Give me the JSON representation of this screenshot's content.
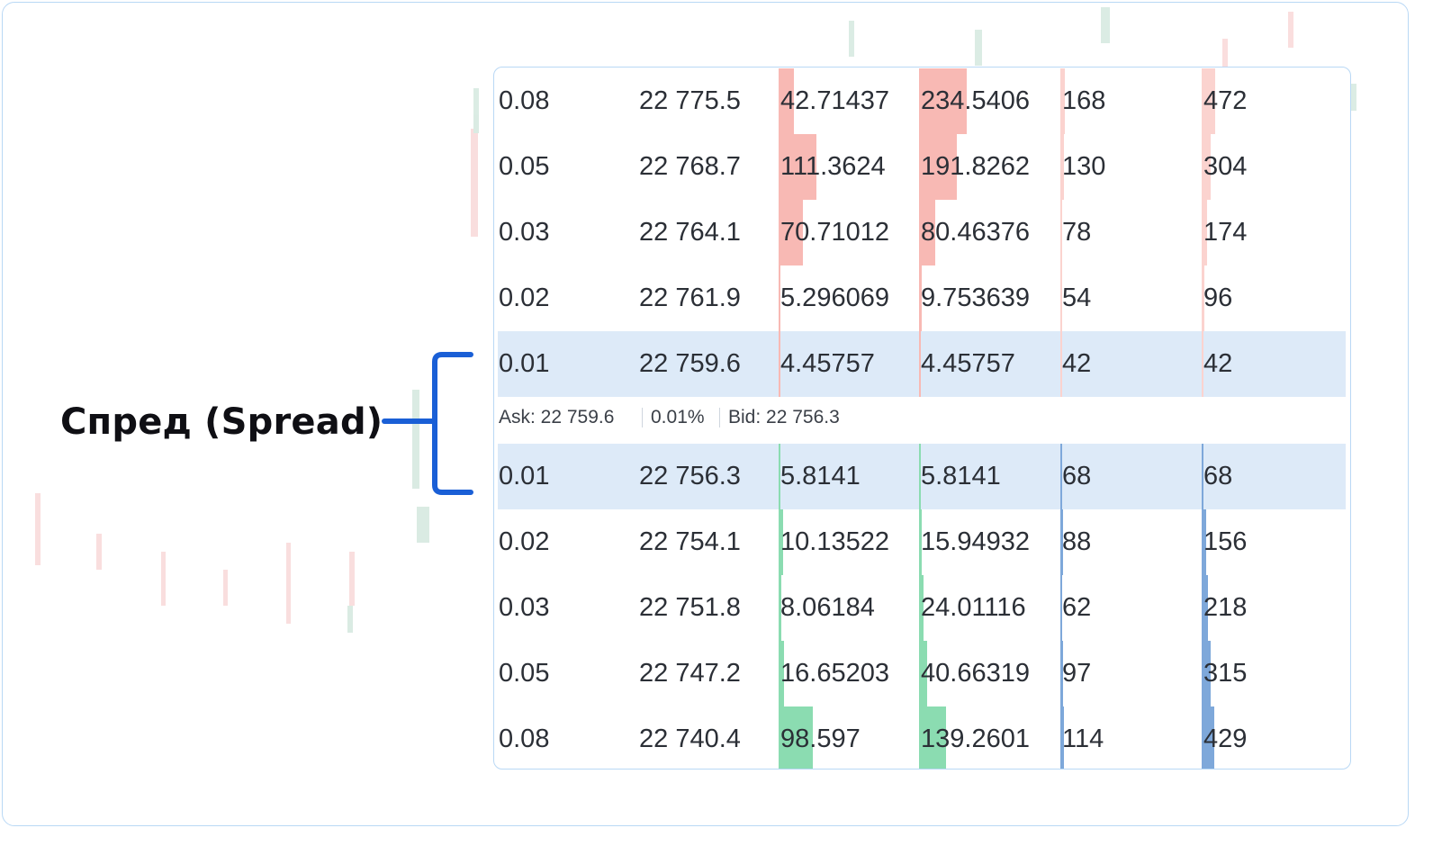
{
  "annotation": {
    "label": "Спред (Spread)"
  },
  "spread": {
    "ask": "Ask: 22 759.6",
    "percent": "0.01%",
    "bid": "Bid: 22 756.3"
  },
  "colors": {
    "ask_bar": "#f8b9b4",
    "bid_bar": "#8bdcb1",
    "count_bar_ask": "#fbd3cf",
    "count_bar_bid": "#7ea8da",
    "highlight": "#ddeaf8",
    "bracket": "#1a5fd6"
  },
  "asks": [
    {
      "spread": "0.08",
      "price": "22 775.5",
      "size": "42.71437",
      "total": "234.5406",
      "count": "168",
      "cum_count": "472",
      "size_level": 0.11,
      "total_level": 0.35,
      "count_level": 0.35,
      "cum_level": 1.0
    },
    {
      "spread": "0.05",
      "price": "22 768.7",
      "size": "111.3624",
      "total": "191.8262",
      "count": "130",
      "cum_count": "304",
      "size_level": 0.28,
      "total_level": 0.28,
      "count_level": 0.27,
      "cum_level": 0.65
    },
    {
      "spread": "0.03",
      "price": "22 764.1",
      "size": "70.71012",
      "total": "80.46376",
      "count": "78",
      "cum_count": "174",
      "size_level": 0.18,
      "total_level": 0.12,
      "count_level": 0.16,
      "cum_level": 0.37
    },
    {
      "spread": "0.02",
      "price": "22 761.9",
      "size": "5.296069",
      "total": "9.753639",
      "count": "54",
      "cum_count": "96",
      "size_level": 0.01,
      "total_level": 0.02,
      "count_level": 0.11,
      "cum_level": 0.2
    },
    {
      "spread": "0.01",
      "price": "22 759.6",
      "size": "4.45757",
      "total": "4.45757",
      "count": "42",
      "cum_count": "42",
      "size_level": 0.01,
      "total_level": 0.01,
      "count_level": 0.09,
      "cum_level": 0.09
    }
  ],
  "bids": [
    {
      "spread": "0.01",
      "price": "22 756.3",
      "size": "5.8141",
      "total": "5.8141",
      "count": "68",
      "cum_count": "68",
      "size_level": 0.01,
      "total_level": 0.01,
      "count_level": 0.14,
      "cum_level": 0.14
    },
    {
      "spread": "0.02",
      "price": "22 754.1",
      "size": "10.13522",
      "total": "15.94932",
      "count": "88",
      "cum_count": "156",
      "size_level": 0.03,
      "total_level": 0.02,
      "count_level": 0.19,
      "cum_level": 0.33
    },
    {
      "spread": "0.03",
      "price": "22 751.8",
      "size": "8.06184",
      "total": "24.01116",
      "count": "62",
      "cum_count": "218",
      "size_level": 0.02,
      "total_level": 0.03,
      "count_level": 0.13,
      "cum_level": 0.46
    },
    {
      "spread": "0.05",
      "price": "22 747.2",
      "size": "16.65203",
      "total": "40.66319",
      "count": "97",
      "cum_count": "315",
      "size_level": 0.04,
      "total_level": 0.06,
      "count_level": 0.2,
      "cum_level": 0.67
    },
    {
      "spread": "0.08",
      "price": "22 740.4",
      "size": "98.597",
      "total": "139.2601",
      "count": "114",
      "cum_count": "429",
      "size_level": 0.25,
      "total_level": 0.2,
      "count_level": 0.24,
      "cum_level": 0.91
    }
  ]
}
